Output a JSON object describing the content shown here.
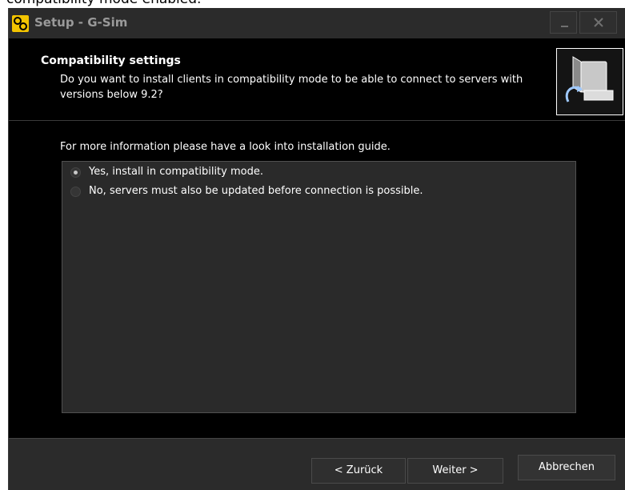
{
  "caption": "compatibility mode enabled.",
  "window": {
    "title": "Setup - G-Sim",
    "app_icon": "gsim-logo-icon",
    "minimize_icon": "minimize-icon",
    "close_icon": "close-icon"
  },
  "header": {
    "title": "Compatibility settings",
    "description": "Do you want to install clients in compatibility mode to be able to connect to servers with versions below 9.2?",
    "image_icon": "computer-install-icon"
  },
  "content": {
    "info": "For more information please have a look into installation guide.",
    "options": [
      {
        "label": "Yes, install in compatibility mode.",
        "selected": true
      },
      {
        "label": "No, servers must also be updated before connection is possible.",
        "selected": false
      }
    ]
  },
  "footer": {
    "back_label": "< Zurück",
    "next_label": "Weiter >",
    "cancel_label": "Abbrechen"
  },
  "colors": {
    "accent": "#f3c400",
    "background": "#000000",
    "chrome": "#2b2b2b"
  }
}
